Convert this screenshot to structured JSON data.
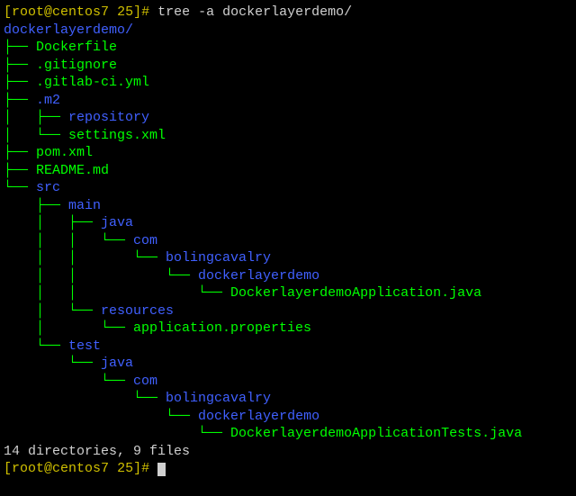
{
  "prompt1": {
    "user_host": "root@centos7",
    "cwd": "25",
    "cmd": "tree -a dockerlayerdemo/"
  },
  "root_dir": "dockerlayerdemo/",
  "tree_lines": [
    {
      "pipe": "├── ",
      "name": "Dockerfile",
      "dir": false
    },
    {
      "pipe": "├── ",
      "name": ".gitignore",
      "dir": false
    },
    {
      "pipe": "├── ",
      "name": ".gitlab-ci.yml",
      "dir": false
    },
    {
      "pipe": "├── ",
      "name": ".m2",
      "dir": true
    },
    {
      "pipe": "│   ├── ",
      "name": "repository",
      "dir": true
    },
    {
      "pipe": "│   └── ",
      "name": "settings.xml",
      "dir": false
    },
    {
      "pipe": "├── ",
      "name": "pom.xml",
      "dir": false
    },
    {
      "pipe": "├── ",
      "name": "README.md",
      "dir": false
    },
    {
      "pipe": "└── ",
      "name": "src",
      "dir": true
    },
    {
      "pipe": "    ├── ",
      "name": "main",
      "dir": true
    },
    {
      "pipe": "    │   ├── ",
      "name": "java",
      "dir": true
    },
    {
      "pipe": "    │   │   └── ",
      "name": "com",
      "dir": true
    },
    {
      "pipe": "    │   │       └── ",
      "name": "bolingcavalry",
      "dir": true
    },
    {
      "pipe": "    │   │           └── ",
      "name": "dockerlayerdemo",
      "dir": true
    },
    {
      "pipe": "    │   │               └── ",
      "name": "DockerlayerdemoApplication.java",
      "dir": false
    },
    {
      "pipe": "    │   └── ",
      "name": "resources",
      "dir": true
    },
    {
      "pipe": "    │       └── ",
      "name": "application.properties",
      "dir": false
    },
    {
      "pipe": "    └── ",
      "name": "test",
      "dir": true
    },
    {
      "pipe": "        └── ",
      "name": "java",
      "dir": true
    },
    {
      "pipe": "            └── ",
      "name": "com",
      "dir": true
    },
    {
      "pipe": "                └── ",
      "name": "bolingcavalry",
      "dir": true
    },
    {
      "pipe": "                    └── ",
      "name": "dockerlayerdemo",
      "dir": true
    },
    {
      "pipe": "                        └── ",
      "name": "DockerlayerdemoApplicationTests.java",
      "dir": false
    }
  ],
  "summary": "14 directories, 9 files",
  "prompt2": {
    "user_host": "root@centos7",
    "cwd": "25"
  }
}
